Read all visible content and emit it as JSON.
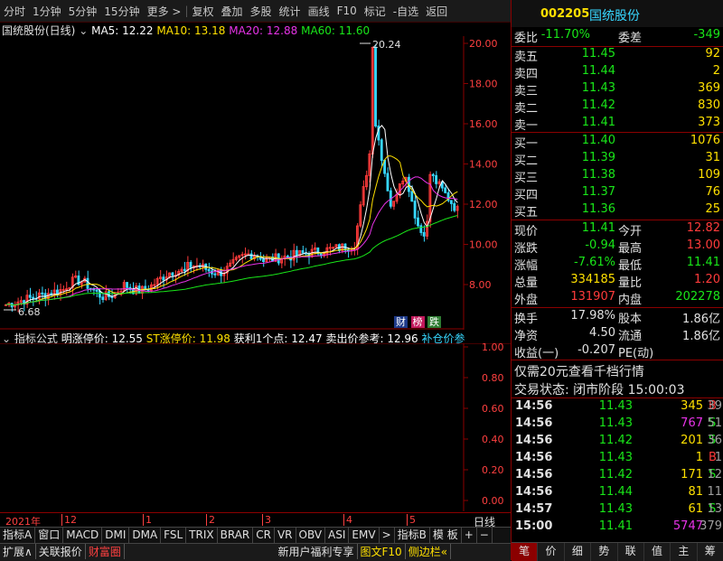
{
  "toolbar": {
    "items": [
      "分时",
      "1分钟",
      "5分钟",
      "15分钟",
      "更多 >",
      "复权",
      "叠加",
      "多股",
      "统计",
      "画线",
      "F10",
      "标记",
      "-自选",
      "返回"
    ]
  },
  "chart": {
    "title": "国统股份(日线)",
    "ma5": "MA5: 12.22",
    "ma10": "MA10: 13.18",
    "ma20": "MA20: 12.88",
    "ma60": "MA60: 11.60",
    "high_label": "20.24",
    "low_label": "6.68",
    "badge_cai": "财",
    "badge_bang": "榜",
    "badge_die": "跌",
    "y_ticks": [
      "20.00",
      "18.00",
      "16.00",
      "14.00",
      "12.00",
      "10.00",
      "8.00"
    ]
  },
  "indicator": {
    "name": "指标公式",
    "limit_up": "明涨停价: 12.55",
    "st_limit": "ST涨停价: 11.98",
    "profit1": "获利1个点: 12.47",
    "sell_ref": "卖出价参考: 12.96",
    "add_ref": "补仓价参考",
    "y_ticks": [
      "1.00",
      "0.80",
      "0.60",
      "0.40",
      "0.20",
      "0.00"
    ]
  },
  "x_axis": {
    "labels": [
      "2021年",
      "12",
      "1",
      "2",
      "3",
      "4",
      "5"
    ],
    "period": "日线"
  },
  "tabs": {
    "items": [
      "指标A",
      "窗口",
      "MACD",
      "DMI",
      "DMA",
      "FSL",
      "TRIX",
      "BRAR",
      "CR",
      "VR",
      "OBV",
      "ASI",
      "EMV",
      ">",
      "指标B",
      "模 板",
      "+",
      "−"
    ]
  },
  "bottom": {
    "left": [
      "扩展∧",
      "关联报价",
      "财富圈"
    ],
    "right": [
      "新用户福利专享",
      "图文F10",
      "侧边栏«"
    ]
  },
  "quote": {
    "code": "002205",
    "name": "国统股份",
    "weibi_label": "委比",
    "weibi": "-11.70%",
    "weicha_label": "委差",
    "weicha": "-349",
    "sells": [
      {
        "label": "卖五",
        "price": "11.45",
        "vol": "92"
      },
      {
        "label": "卖四",
        "price": "11.44",
        "vol": "2"
      },
      {
        "label": "卖三",
        "price": "11.43",
        "vol": "369"
      },
      {
        "label": "卖二",
        "price": "11.42",
        "vol": "830"
      },
      {
        "label": "卖一",
        "price": "11.41",
        "vol": "373"
      }
    ],
    "buys": [
      {
        "label": "买一",
        "price": "11.40",
        "vol": "1076"
      },
      {
        "label": "买二",
        "price": "11.39",
        "vol": "31"
      },
      {
        "label": "买三",
        "price": "11.38",
        "vol": "109"
      },
      {
        "label": "买四",
        "price": "11.37",
        "vol": "76"
      },
      {
        "label": "买五",
        "price": "11.36",
        "vol": "25"
      }
    ],
    "stats": [
      {
        "l1": "现价",
        "v1": "11.41",
        "l2": "今开",
        "v2": "12.82"
      },
      {
        "l1": "涨跌",
        "v1": "-0.94",
        "l2": "最高",
        "v2": "13.00"
      },
      {
        "l1": "涨幅",
        "v1": "-7.61%",
        "l2": "最低",
        "v2": "11.41"
      },
      {
        "l1": "总量",
        "v1": "334185",
        "l2": "量比",
        "v2": "1.20"
      },
      {
        "l1": "外盘",
        "v1": "131907",
        "l2": "内盘",
        "v2": "202278"
      }
    ],
    "stats2": [
      {
        "l1": "换手",
        "v1": "17.98%",
        "l2": "股本",
        "v2": "1.86亿"
      },
      {
        "l1": "净资",
        "v1": "4.50",
        "l2": "流通",
        "v2": "1.86亿"
      },
      {
        "l1": "收益(一)",
        "v1": "-0.207",
        "l2": "PE(动)",
        "v2": ""
      }
    ],
    "promo": "仅需20元查看千档行情",
    "status": "交易状态: 闭市阶段 15:00:03",
    "ticks": [
      {
        "t": "14:56",
        "p": "11.43",
        "v": "345",
        "f": "B",
        "n": "39"
      },
      {
        "t": "14:56",
        "p": "11.43",
        "v": "767",
        "f": "S",
        "n": "51"
      },
      {
        "t": "14:56",
        "p": "11.42",
        "v": "201",
        "f": "S",
        "n": "36"
      },
      {
        "t": "14:56",
        "p": "11.43",
        "v": "1",
        "f": "B",
        "n": "1"
      },
      {
        "t": "14:56",
        "p": "11.42",
        "v": "171",
        "f": "S",
        "n": "12"
      },
      {
        "t": "14:56",
        "p": "11.44",
        "v": "81",
        "f": "",
        "n": "11"
      },
      {
        "t": "14:57",
        "p": "11.43",
        "v": "61",
        "f": "S",
        "n": "13"
      },
      {
        "t": "15:00",
        "p": "11.41",
        "v": "5747",
        "f": "",
        "n": "379"
      }
    ],
    "footer": [
      "笔",
      "价",
      "细",
      "势",
      "联",
      "值",
      "主",
      "筹"
    ]
  }
}
